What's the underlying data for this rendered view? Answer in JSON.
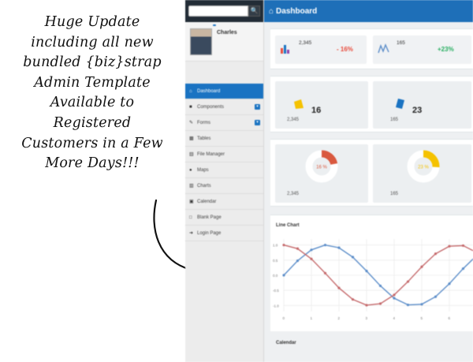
{
  "promo": {
    "lines": [
      "Huge Update",
      "including all new",
      "bundled {biz}strap",
      "Admin Template",
      "Available to",
      "Registered",
      "Customers in a Few",
      "More Days!!!"
    ]
  },
  "icons": [
    "search-icon",
    "home-icon",
    "blocks-icon",
    "pencil-icon",
    "table-icon",
    "file-icon",
    "map-marker-icon",
    "chart-icon",
    "calendar-icon",
    "page-icon",
    "login-icon"
  ],
  "colors": {
    "primary": "#1a73c2",
    "header": "#1e6fb8",
    "red": "#e84c3d",
    "green": "#27ae60",
    "yellow": "#f5c200"
  },
  "search": {
    "placeholder": "",
    "button": "🔍"
  },
  "profile": {
    "name": "Charles"
  },
  "nav": [
    {
      "label": "Dashboard",
      "active": true
    },
    {
      "label": "Components"
    },
    {
      "label": "Forms"
    },
    {
      "label": "Tables"
    },
    {
      "label": "File Manager"
    },
    {
      "label": "Maps"
    },
    {
      "label": "Charts"
    },
    {
      "label": "Calendar"
    },
    {
      "label": "Blank Page"
    },
    {
      "label": "Login Page"
    }
  ],
  "header": {
    "title": "Dashboard"
  },
  "stats": [
    {
      "value": "2,345",
      "delta": "- 16%"
    },
    {
      "value": "165",
      "delta": "+23%"
    }
  ],
  "cards_row1": [
    {
      "num": "16",
      "foot_value": "2,345"
    },
    {
      "num": "23",
      "foot_value": "165"
    }
  ],
  "cards_row2": [
    {
      "ring_value": "16 %",
      "foot_value": "2,345"
    },
    {
      "ring_value": "23 %",
      "foot_value": "165"
    }
  ],
  "chart_title": "Line Chart",
  "calendar_title": "Calendar",
  "chart_data": {
    "type": "line",
    "x": [
      0,
      0.5,
      1,
      1.5,
      2,
      2.5,
      3,
      3.5,
      4,
      4.5,
      5,
      5.5,
      6,
      6.5,
      7
    ],
    "series": [
      {
        "values": [
          0,
          0.48,
          0.84,
          1,
          0.91,
          0.6,
          0.14,
          -0.35,
          -0.76,
          -0.98,
          -0.96,
          -0.71,
          -0.28,
          0.22,
          0.66
        ]
      },
      {
        "values": [
          1,
          0.88,
          0.54,
          0.07,
          -0.42,
          -0.8,
          -0.99,
          -0.94,
          -0.65,
          -0.21,
          0.28,
          0.71,
          0.96,
          0.98,
          0.75
        ]
      }
    ],
    "series_colors": [
      "#5b8dc9",
      "#c5696b"
    ],
    "xticks": [
      "0",
      "1",
      "2",
      "3",
      "4",
      "5",
      "6"
    ],
    "yticks": [
      "1.0",
      "0.5",
      "0.0",
      "-0.5",
      "-1.0"
    ],
    "ylim": [
      -1.2,
      1.2
    ],
    "xlim": [
      0,
      7
    ],
    "grid": true
  }
}
